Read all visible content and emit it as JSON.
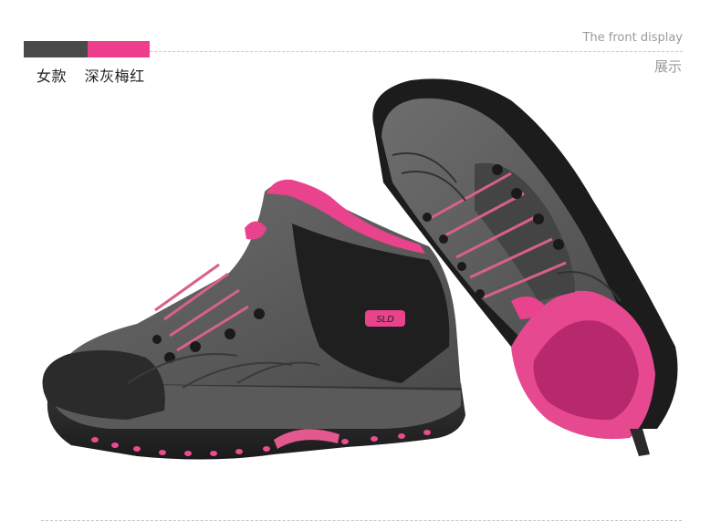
{
  "header": {
    "left_labels": [
      "女款",
      "深灰梅红"
    ],
    "right_en": "The front display",
    "right_cn": "展示",
    "colors": {
      "bar_dark": "#4a4a4a",
      "bar_pink": "#ee3d8b"
    }
  },
  "image": {
    "logo_text": "SLD"
  }
}
